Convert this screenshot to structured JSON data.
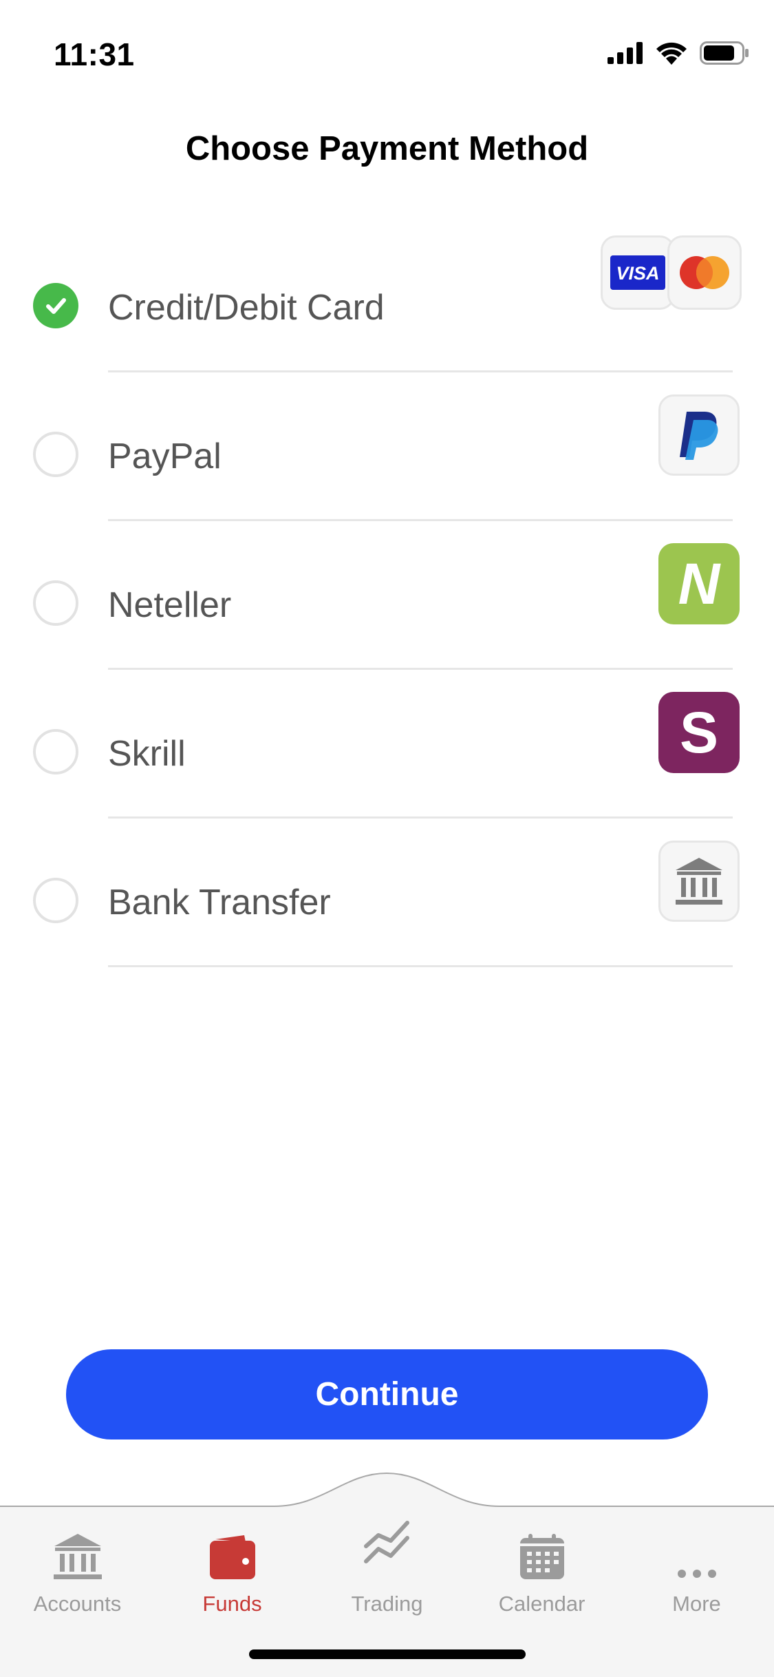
{
  "status_bar": {
    "time": "11:31"
  },
  "page": {
    "title": "Choose Payment Method"
  },
  "methods": [
    {
      "label": "Credit/Debit Card",
      "selected": true,
      "icons": [
        "visa-icon",
        "mastercard-icon"
      ]
    },
    {
      "label": "PayPal",
      "selected": false,
      "icons": [
        "paypal-icon"
      ]
    },
    {
      "label": "Neteller",
      "selected": false,
      "icons": [
        "neteller-icon"
      ]
    },
    {
      "label": "Skrill",
      "selected": false,
      "icons": [
        "skrill-icon"
      ]
    },
    {
      "label": "Bank Transfer",
      "selected": false,
      "icons": [
        "bank-icon"
      ]
    }
  ],
  "visa": {
    "text": "VISA"
  },
  "neteller": {
    "letter": "N"
  },
  "skrill": {
    "letter": "S"
  },
  "actions": {
    "continue_label": "Continue"
  },
  "tabs": [
    {
      "label": "Accounts",
      "icon": "bank-icon",
      "active": false
    },
    {
      "label": "Funds",
      "icon": "wallet-icon",
      "active": true
    },
    {
      "label": "Trading",
      "icon": "chart-icon",
      "active": false
    },
    {
      "label": "Calendar",
      "icon": "calendar-icon",
      "active": false
    },
    {
      "label": "More",
      "icon": "more-icon",
      "active": false
    }
  ],
  "colors": {
    "accent": "#2252f5",
    "selected_check": "#47b94a",
    "active_tab": "#c73a36",
    "neteller": "#9cc54f",
    "skrill": "#7d255f",
    "visa": "#1a27c9"
  }
}
